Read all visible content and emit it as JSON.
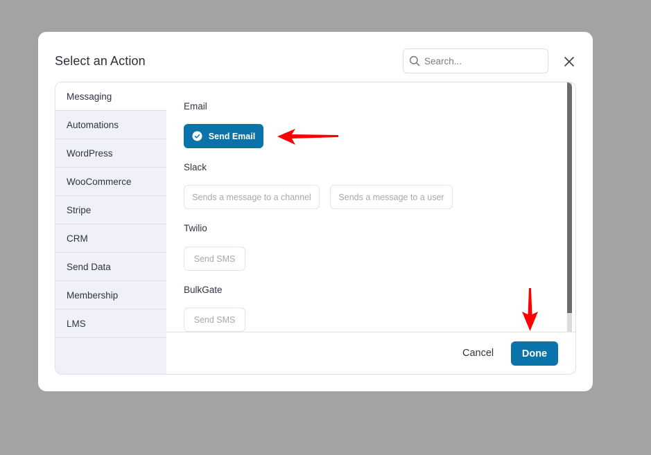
{
  "modal": {
    "title": "Select an Action",
    "search": {
      "placeholder": "Search...",
      "value": ""
    },
    "close_icon": "close-icon"
  },
  "sidebar": {
    "active_index": 0,
    "items": [
      {
        "label": "Messaging"
      },
      {
        "label": "Automations"
      },
      {
        "label": "WordPress"
      },
      {
        "label": "WooCommerce"
      },
      {
        "label": "Stripe"
      },
      {
        "label": "CRM"
      },
      {
        "label": "Send Data"
      },
      {
        "label": "Membership"
      },
      {
        "label": "LMS"
      }
    ]
  },
  "groups": [
    {
      "label": "Email",
      "actions": [
        {
          "label": "Send Email",
          "selected": true,
          "icon": "check-circle-icon"
        }
      ]
    },
    {
      "label": "Slack",
      "actions": [
        {
          "label": "Sends a message to a channel",
          "selected": false
        },
        {
          "label": "Sends a message to a user",
          "selected": false
        }
      ]
    },
    {
      "label": "Twilio",
      "actions": [
        {
          "label": "Send SMS",
          "selected": false
        }
      ]
    },
    {
      "label": "BulkGate",
      "actions": [
        {
          "label": "Send SMS",
          "selected": false
        }
      ]
    }
  ],
  "footer": {
    "cancel_label": "Cancel",
    "done_label": "Done"
  },
  "colors": {
    "primary": "#0a73aa",
    "backdrop": "#a3a3a3",
    "sidebar_bg": "#f0f0f9",
    "annotation_arrow": "#ff0000"
  },
  "annotations": [
    {
      "type": "arrow",
      "direction": "left",
      "points_to": "Send Email"
    },
    {
      "type": "arrow",
      "direction": "down",
      "points_to": "Done"
    }
  ]
}
